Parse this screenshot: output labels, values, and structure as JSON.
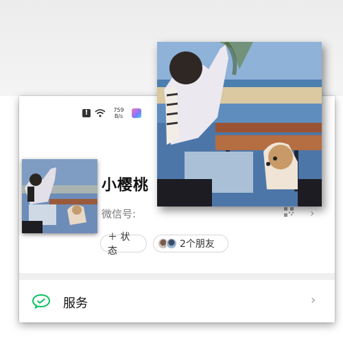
{
  "status_bar": {
    "speed_value": "759",
    "speed_unit": "B/s",
    "alert_icon": "alert-icon",
    "wifi_icon": "wifi-icon",
    "app_icon": "app-icon"
  },
  "profile": {
    "name": "小樱桃",
    "wechat_id_label": "微信号:",
    "qr_icon": "qr-code-icon",
    "chevron": "›"
  },
  "actions": {
    "status_label": "＋ 状态",
    "friends_label": "2个朋友"
  },
  "menu": {
    "service_label": "服务",
    "service_icon": "wechat-pay-icon",
    "chevron": "›"
  },
  "colors": {
    "wechat_green": "#07c160",
    "background": "#ffffff",
    "divider": "#efefef"
  }
}
